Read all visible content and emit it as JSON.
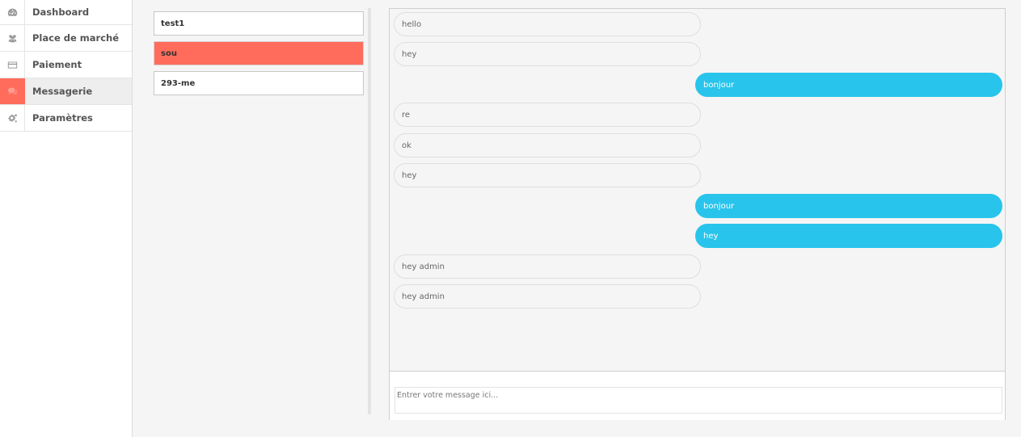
{
  "sidebar": {
    "items": [
      {
        "label": "Dashboard",
        "icon": "dashboard-icon",
        "active": false
      },
      {
        "label": "Place de marché",
        "icon": "users-icon",
        "active": false
      },
      {
        "label": "Paiement",
        "icon": "credit-card-icon",
        "active": false
      },
      {
        "label": "Messagerie",
        "icon": "comments-icon",
        "active": true
      },
      {
        "label": "Paramètres",
        "icon": "cogs-icon",
        "active": false
      }
    ]
  },
  "conversations": [
    {
      "name": "test1",
      "active": false
    },
    {
      "name": "sou",
      "active": true
    },
    {
      "name": "293-me",
      "active": false
    }
  ],
  "messages": [
    {
      "text": "hello",
      "direction": "in"
    },
    {
      "text": "hey",
      "direction": "in"
    },
    {
      "text": "bonjour",
      "direction": "out"
    },
    {
      "text": "re",
      "direction": "in"
    },
    {
      "text": "ok",
      "direction": "in"
    },
    {
      "text": "hey",
      "direction": "in"
    },
    {
      "text": "bonjour",
      "direction": "out"
    },
    {
      "text": "hey",
      "direction": "out"
    },
    {
      "text": "hey admin",
      "direction": "in"
    },
    {
      "text": "hey admin",
      "direction": "in"
    }
  ],
  "compose": {
    "placeholder": "Entrer votre message ici...",
    "value": ""
  },
  "colors": {
    "accent": "#ff6c5c",
    "outgoing_bubble": "#29c4eb"
  }
}
